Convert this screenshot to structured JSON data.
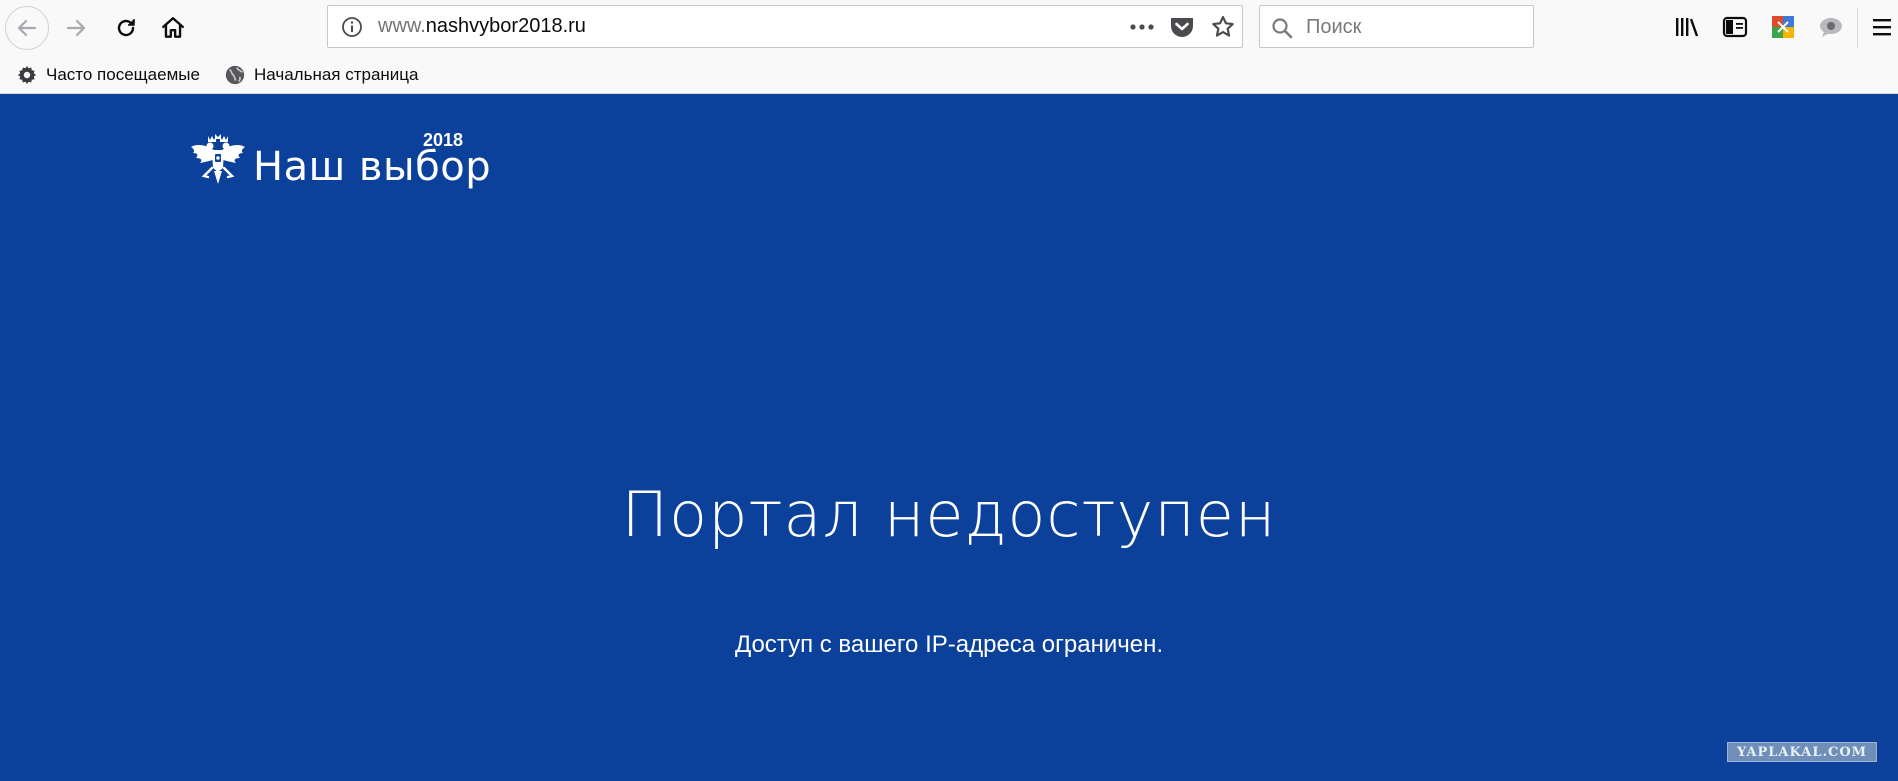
{
  "browser": {
    "url": {
      "prefix": "www.",
      "host": "nashvybor2018.ru"
    },
    "search": {
      "placeholder": "Поиск"
    },
    "bookmarks": [
      {
        "label": "Часто посещаемые",
        "icon": "gear-icon"
      },
      {
        "label": "Начальная страница",
        "icon": "globe-icon"
      }
    ]
  },
  "page": {
    "logo": {
      "text": "Наш выбор",
      "year": "2018"
    },
    "headline": "Портал недоступен",
    "message": "Доступ с вашего IP-адреса ограничен.",
    "watermark": "YAPLAKAL.COM"
  },
  "colors": {
    "page_background": "#0b419b",
    "chrome_background": "#f9f9fa",
    "text_on_page": "#ffffff"
  }
}
